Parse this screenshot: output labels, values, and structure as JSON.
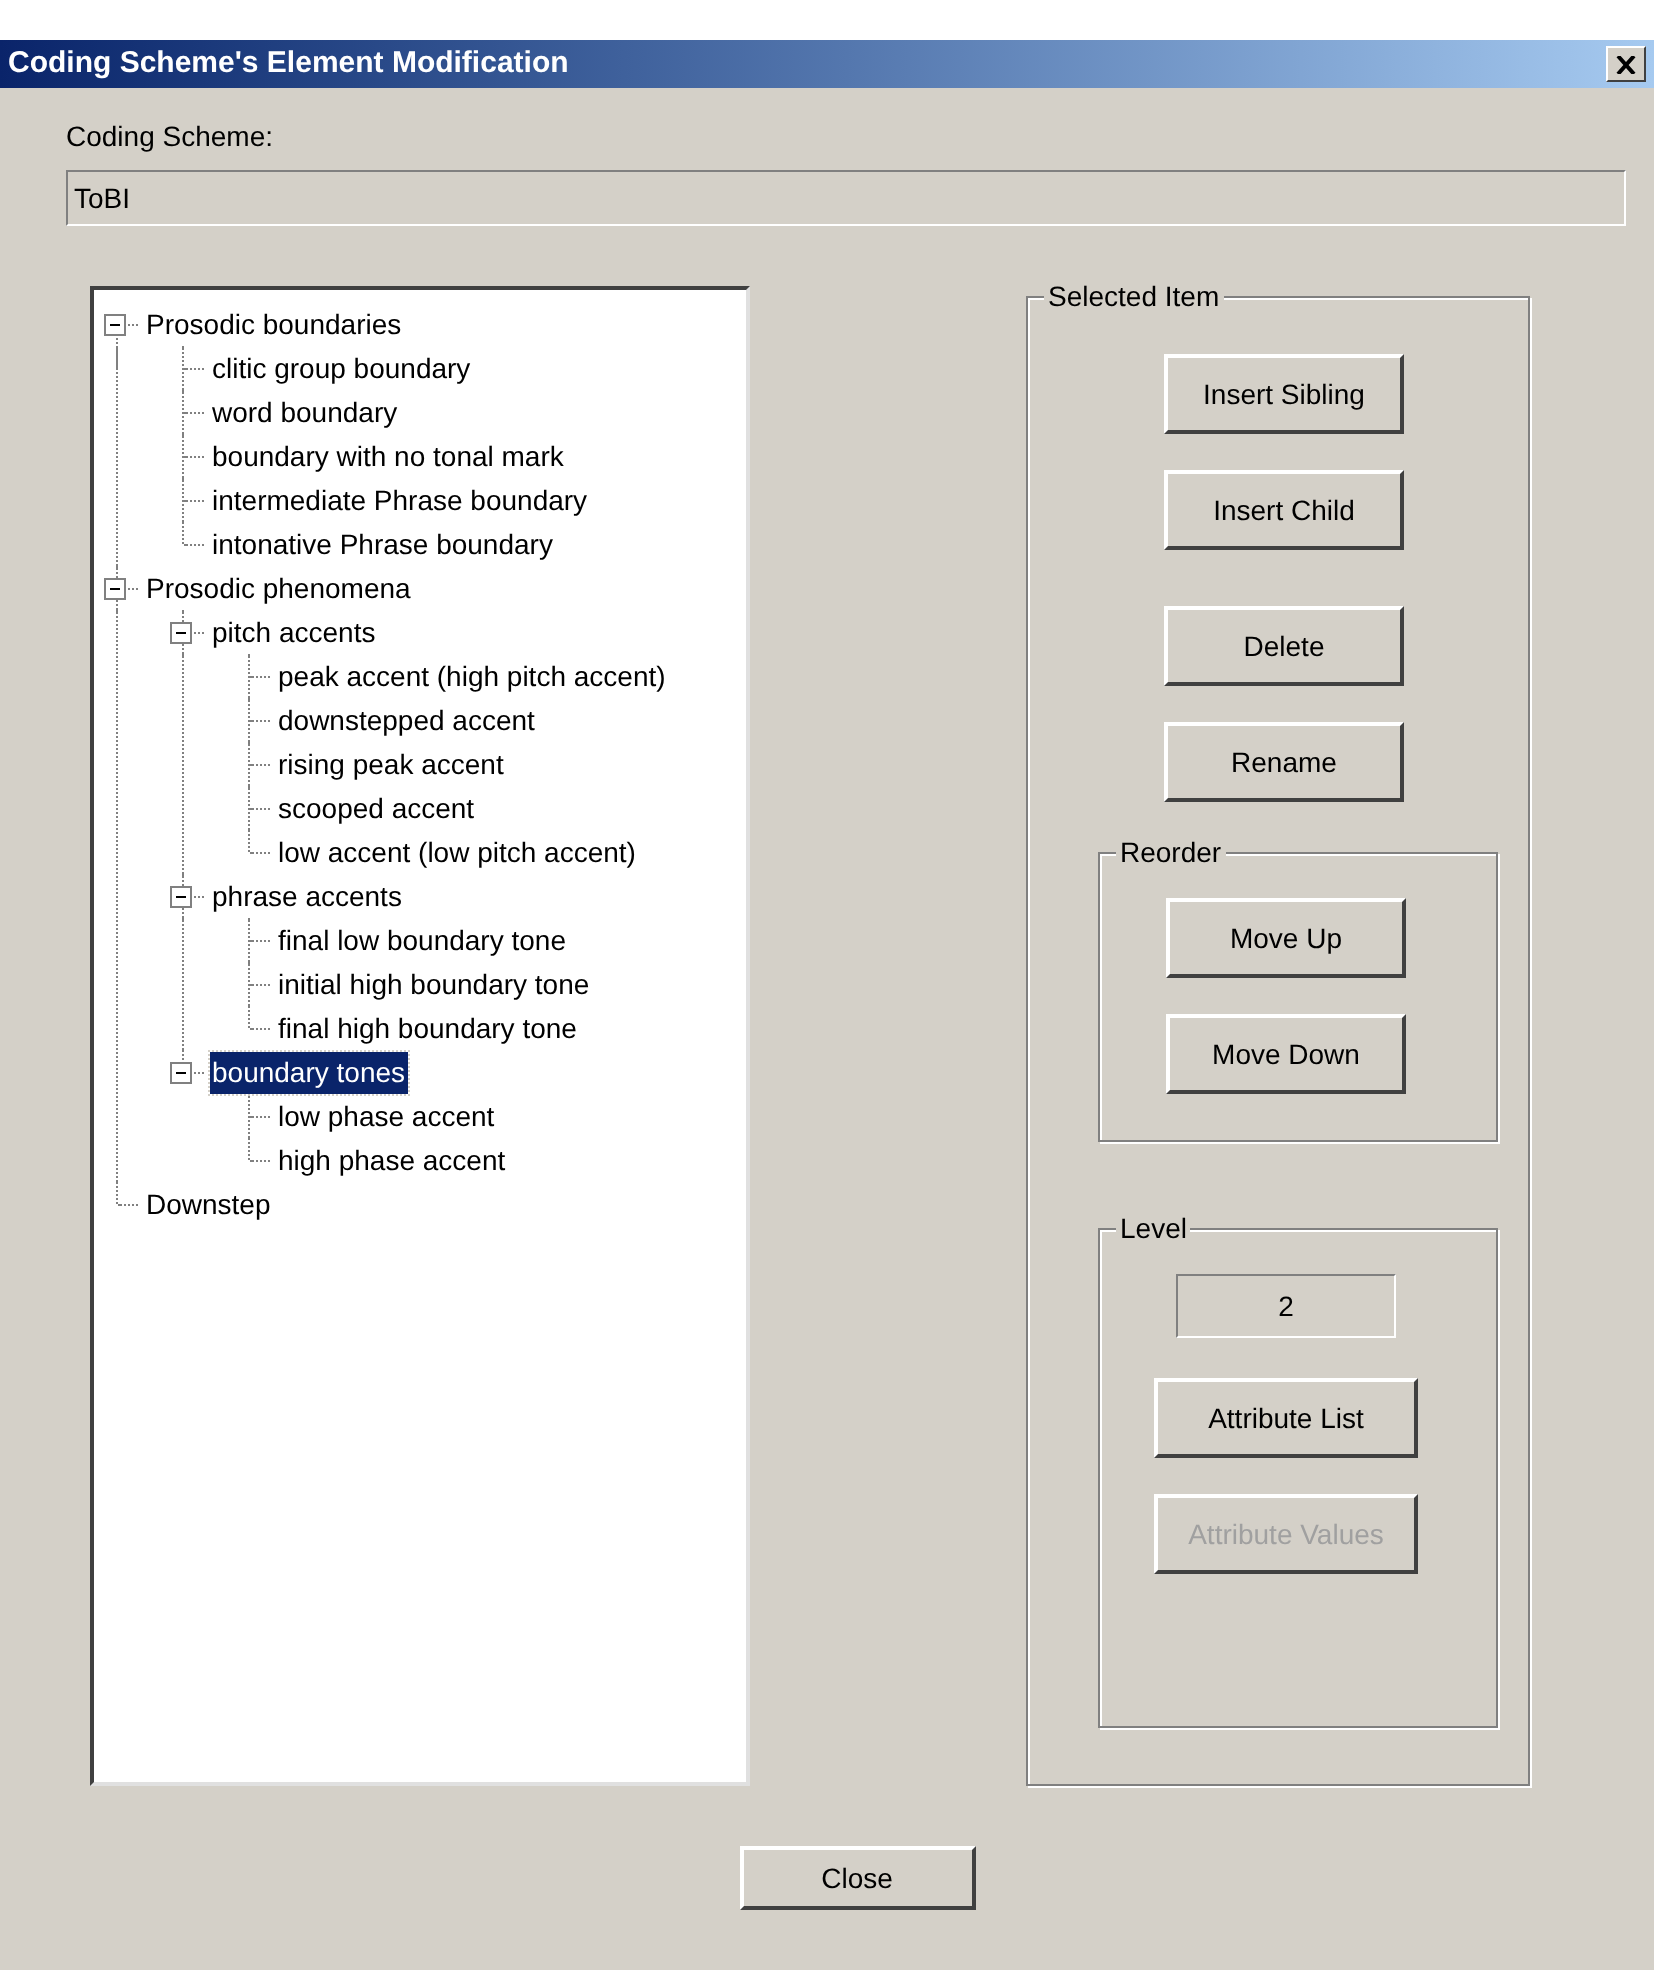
{
  "window": {
    "title": "Coding Scheme's Element Modification"
  },
  "scheme": {
    "label": "Coding Scheme:",
    "value": "ToBI"
  },
  "tree": [
    {
      "label": "Prosodic boundaries",
      "expanded": true,
      "selected": false,
      "children": [
        {
          "label": "clitic group boundary",
          "selected": false
        },
        {
          "label": "word boundary",
          "selected": false
        },
        {
          "label": "boundary with no tonal mark",
          "selected": false
        },
        {
          "label": "intermediate Phrase boundary",
          "selected": false
        },
        {
          "label": "intonative Phrase boundary",
          "selected": false
        }
      ]
    },
    {
      "label": "Prosodic phenomena",
      "expanded": true,
      "selected": false,
      "children": [
        {
          "label": "pitch accents",
          "expanded": true,
          "selected": false,
          "children": [
            {
              "label": "peak accent (high pitch accent)",
              "selected": false
            },
            {
              "label": "downstepped accent",
              "selected": false
            },
            {
              "label": "rising peak accent",
              "selected": false
            },
            {
              "label": "scooped accent",
              "selected": false
            },
            {
              "label": "low accent (low pitch accent)",
              "selected": false
            }
          ]
        },
        {
          "label": "phrase accents",
          "expanded": true,
          "selected": false,
          "children": [
            {
              "label": "final low boundary tone",
              "selected": false
            },
            {
              "label": "initial high boundary tone",
              "selected": false
            },
            {
              "label": "final high boundary tone",
              "selected": false
            }
          ]
        },
        {
          "label": "boundary tones",
          "expanded": true,
          "selected": true,
          "children": [
            {
              "label": "low phase accent",
              "selected": false
            },
            {
              "label": "high phase accent",
              "selected": false
            }
          ]
        }
      ]
    },
    {
      "label": "Downstep",
      "selected": false
    }
  ],
  "selected_item": {
    "title": "Selected Item",
    "buttons": [
      {
        "label": "Insert Sibling",
        "disabled": false
      },
      {
        "label": "Insert Child",
        "disabled": false
      },
      {
        "label": "Delete",
        "disabled": false
      },
      {
        "label": "Rename",
        "disabled": false
      }
    ],
    "reorder": {
      "title": "Reorder",
      "buttons": [
        {
          "label": "Move Up",
          "disabled": false
        },
        {
          "label": "Move Down",
          "disabled": false
        }
      ]
    },
    "level": {
      "title": "Level",
      "value": "2",
      "buttons": [
        {
          "label": "Attribute List",
          "disabled": false
        },
        {
          "label": "Attribute Values",
          "disabled": true
        }
      ]
    }
  },
  "footer": {
    "buttons": [
      {
        "label": "Close",
        "disabled": false
      }
    ]
  }
}
